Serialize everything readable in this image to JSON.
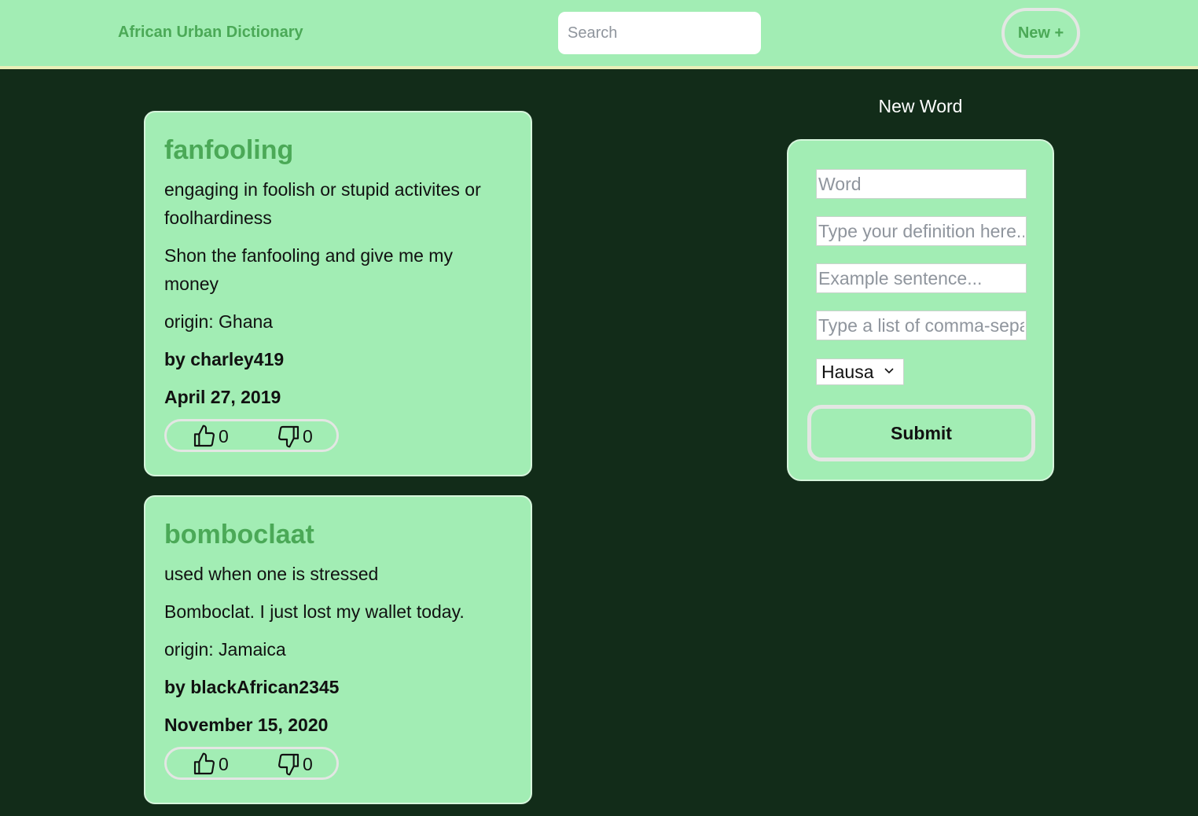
{
  "header": {
    "brand": "African Urban Dictionary",
    "search_placeholder": "Search",
    "new_button": "New +"
  },
  "entries": [
    {
      "word": "fanfooling",
      "definition": "engaging in foolish or stupid activites or foolhardiness",
      "example": "Shon the fanfooling and give me my money",
      "origin": "origin: Ghana",
      "author": "by charley419",
      "date": "April 27, 2019",
      "upvotes": "0",
      "downvotes": "0"
    },
    {
      "word": "bomboclaat",
      "definition": "used when one is stressed",
      "example": "Bomboclat. I just lost my wallet today.",
      "origin": "origin: Jamaica",
      "author": "by blackAfrican2345",
      "date": "November 15, 2020",
      "upvotes": "0",
      "downvotes": "0"
    }
  ],
  "form": {
    "title": "New Word",
    "word_placeholder": "Word",
    "definition_placeholder": "Type your definition here...",
    "example_placeholder": "Example sentence...",
    "tags_placeholder": "Type a list of comma-separated tags",
    "language_selected": "Hausa",
    "submit_label": "Submit"
  },
  "icons": {
    "upvote": "thumbs-up-icon",
    "downvote": "thumbs-down-icon",
    "dropdown": "chevron-down-icon"
  }
}
